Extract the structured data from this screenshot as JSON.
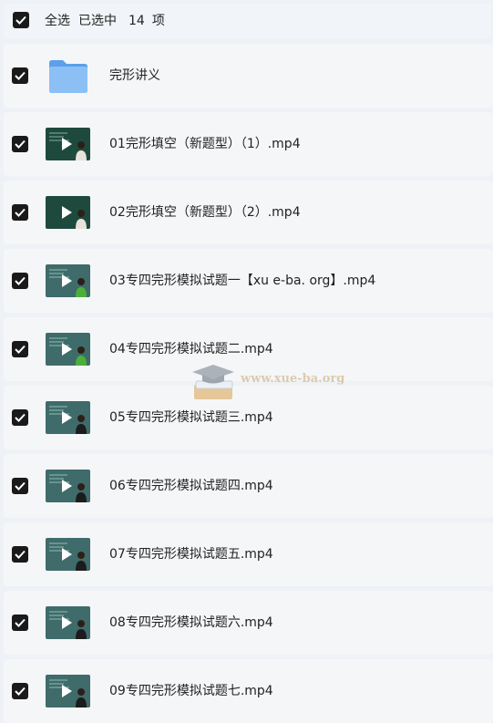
{
  "header": {
    "select_all": "全选",
    "selected_prefix": "已选中",
    "selected_count": "14",
    "selected_suffix": "项"
  },
  "rows": [
    {
      "name": "完形讲义",
      "type": "folder"
    },
    {
      "name": "01完形填空（新题型）（1）.mp4",
      "type": "video"
    },
    {
      "name": "02完形填空（新题型）（2）.mp4",
      "type": "video"
    },
    {
      "name": "03专四完形模拟试题一【xu e-ba. org】.mp4",
      "type": "video"
    },
    {
      "name": "04专四完形模拟试题二.mp4",
      "type": "video"
    },
    {
      "name": "05专四完形模拟试题三.mp4",
      "type": "video"
    },
    {
      "name": "06专四完形模拟试题四.mp4",
      "type": "video"
    },
    {
      "name": "07专四完形模拟试题五.mp4",
      "type": "video"
    },
    {
      "name": "08专四完形模拟试题六.mp4",
      "type": "video"
    },
    {
      "name": "09专四完形模拟试题七.mp4",
      "type": "video"
    }
  ],
  "watermark": {
    "text": "www.xue-ba.org"
  },
  "colors": {
    "checkbox": "#1a1a1a",
    "row_bg": "#f5f6f8",
    "page_bg": "#eef1f6",
    "folder": "#7fb6f2",
    "watermark": "#c8a86e"
  }
}
